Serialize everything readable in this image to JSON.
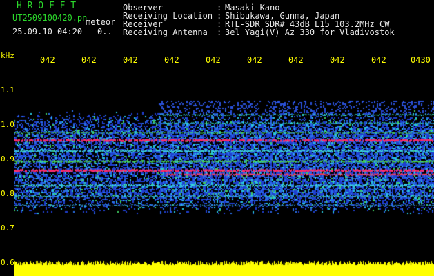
{
  "header": {
    "title": "H R O F F T",
    "filename": "UT2509100420.pn",
    "mode": "meteor",
    "datetime": "25.09.10 04:20",
    "counter": "0..",
    "fields": [
      {
        "label": "Observer",
        "value": "Masaki Kano"
      },
      {
        "label": "Receiving Location",
        "value": "Shibukawa, Gunma, Japan"
      },
      {
        "label": "Receiver",
        "value": "RTL-SDR SDR# 43dB L15 103.2MHz CW"
      },
      {
        "label": "Receiving Antenna",
        "value": "3el Yagi(V) Az 330 for Vladivostok"
      }
    ],
    "separator": ":"
  },
  "axis": {
    "unit": "kHz",
    "y_ticks": [
      "1.1",
      "1.0",
      "0.9",
      "0.8",
      "0.7",
      "0.6"
    ],
    "x_ticks": [
      "042",
      "042",
      "042",
      "042",
      "042",
      "042",
      "042",
      "042",
      "042",
      "0430"
    ]
  },
  "colors": {
    "background": "#000000",
    "text_green": "#2bd82b",
    "text_white": "#e8e8e8",
    "axis_yellow": "#ffff00",
    "noise_blue": "#1f3fd0",
    "signal_red": "#ff2a6a"
  }
}
